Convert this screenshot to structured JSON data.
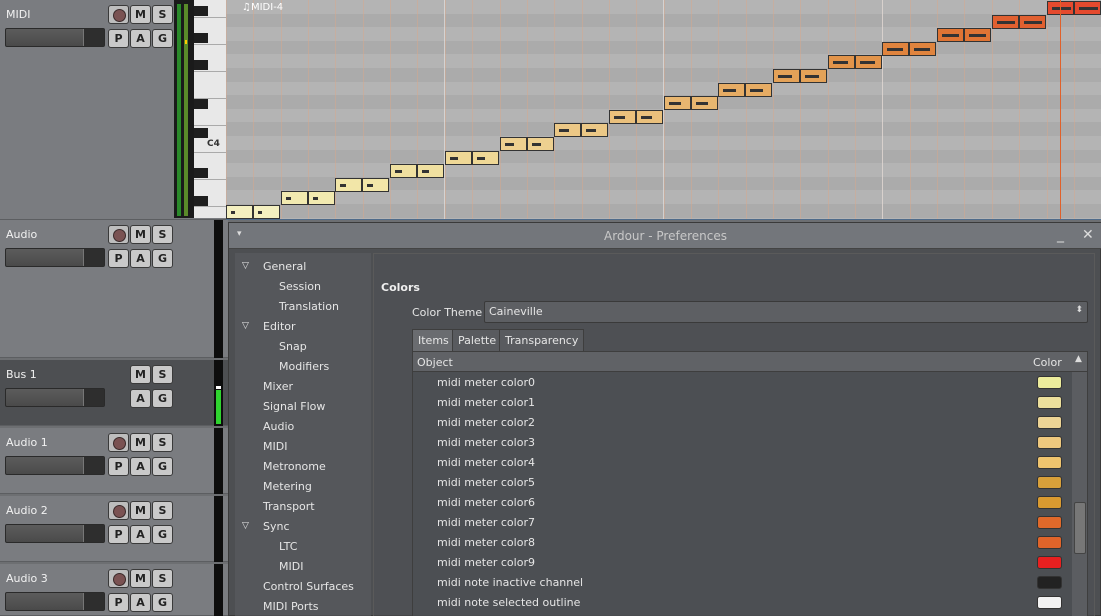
{
  "tracks": [
    {
      "name": "MIDI",
      "buttons": [
        "M",
        "S",
        "P",
        "A",
        "G"
      ]
    },
    {
      "name": "Audio",
      "buttons": [
        "M",
        "S",
        "P",
        "A",
        "G"
      ]
    },
    {
      "name": "Bus 1",
      "buttons": [
        "M",
        "S",
        "A",
        "G"
      ]
    },
    {
      "name": "Audio 1",
      "buttons": [
        "M",
        "S",
        "P",
        "A",
        "G"
      ]
    },
    {
      "name": "Audio 2",
      "buttons": [
        "M",
        "S",
        "P",
        "A",
        "G"
      ]
    },
    {
      "name": "Audio 3",
      "buttons": [
        "M",
        "S",
        "P",
        "A",
        "G"
      ]
    }
  ],
  "piano": {
    "c4_label": "C4"
  },
  "region": {
    "label": "♫MIDI-4"
  },
  "dialog": {
    "title": "Ardour - Preferences",
    "minimize": "_",
    "close": "✕",
    "tree": [
      {
        "label": "General",
        "expanded": true
      },
      {
        "label": "Session"
      },
      {
        "label": "Translation"
      },
      {
        "label": "Editor",
        "expanded": true
      },
      {
        "label": "Snap"
      },
      {
        "label": "Modifiers"
      },
      {
        "label": "Mixer"
      },
      {
        "label": "Signal Flow"
      },
      {
        "label": "Audio"
      },
      {
        "label": "MIDI"
      },
      {
        "label": "Metronome"
      },
      {
        "label": "Metering"
      },
      {
        "label": "Transport"
      },
      {
        "label": "Sync",
        "expanded": true
      },
      {
        "label": "LTC"
      },
      {
        "label": "MIDI"
      },
      {
        "label": "Control Surfaces"
      },
      {
        "label": "MIDI Ports"
      }
    ],
    "section": "Colors",
    "theme_label": "Color Theme",
    "theme_value": "Caineville",
    "tabs": [
      "Items",
      "Palette",
      "Transparency"
    ],
    "active_tab": "Items",
    "col_object": "Object",
    "col_color": "Color",
    "items": [
      {
        "name": "midi meter color0",
        "color": "#ecec9c"
      },
      {
        "name": "midi meter color1",
        "color": "#ecdf9c"
      },
      {
        "name": "midi meter color2",
        "color": "#edd495"
      },
      {
        "name": "midi meter color3",
        "color": "#eec87e"
      },
      {
        "name": "midi meter color4",
        "color": "#efc46e"
      },
      {
        "name": "midi meter color5",
        "color": "#d8a03a"
      },
      {
        "name": "midi meter color6",
        "color": "#d99a30"
      },
      {
        "name": "midi meter color7",
        "color": "#e0692a"
      },
      {
        "name": "midi meter color8",
        "color": "#e0642a"
      },
      {
        "name": "midi meter color9",
        "color": "#e82020"
      },
      {
        "name": "midi note inactive channel",
        "color": "#222222"
      },
      {
        "name": "midi note selected outline",
        "color": "#f2f2f2"
      }
    ]
  },
  "notes": [
    {
      "color": "#f4f0c0"
    },
    {
      "color": "#f2eab0"
    },
    {
      "color": "#f2e6a8"
    },
    {
      "color": "#f0e0a0"
    },
    {
      "color": "#efd896"
    },
    {
      "color": "#eed090"
    },
    {
      "color": "#ecc886"
    },
    {
      "color": "#eac07c"
    },
    {
      "color": "#e8b670"
    },
    {
      "color": "#e6ac64"
    },
    {
      "color": "#e4a258"
    },
    {
      "color": "#e2944a"
    },
    {
      "color": "#e0843e"
    },
    {
      "color": "#df7434"
    },
    {
      "color": "#e06030"
    },
    {
      "color": "#e44a2e"
    }
  ]
}
